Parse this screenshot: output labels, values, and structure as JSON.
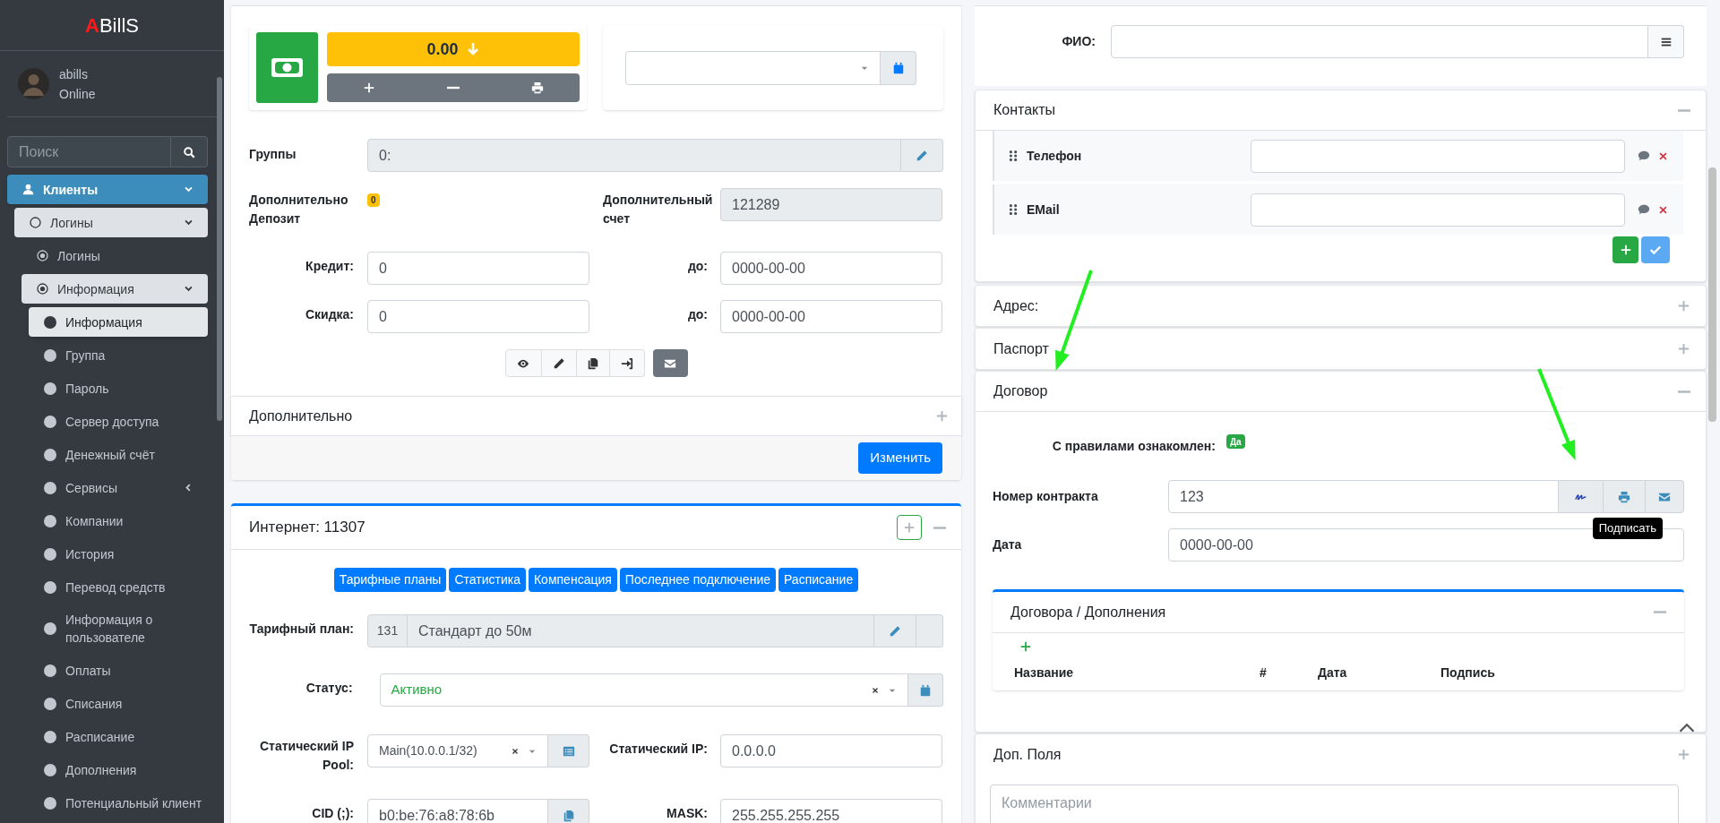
{
  "sidebar": {
    "logo": {
      "accent": "A",
      "rest": "BillS"
    },
    "user": {
      "name": "abills",
      "status": "Online"
    },
    "search": {
      "placeholder": "Поиск"
    },
    "menu": [
      {
        "label": "Клиенты",
        "kind": "user",
        "selected": true,
        "expanded": true,
        "children": [
          {
            "label": "Логины",
            "kind": "circle-outline",
            "selected": false,
            "expanded": true,
            "children": [
              {
                "label": "Логины",
                "kind": "dot-circle",
                "selected": false
              },
              {
                "label": "Информация",
                "kind": "dot-circle",
                "selected": false,
                "expanded": true,
                "children": [
                  {
                    "label": "Информация",
                    "kind": "circle",
                    "selected": true
                  },
                  {
                    "label": "Группа",
                    "kind": "circle",
                    "selected": false
                  },
                  {
                    "label": "Пароль",
                    "kind": "circle",
                    "selected": false
                  },
                  {
                    "label": "Сервер доступа",
                    "kind": "circle",
                    "selected": false
                  },
                  {
                    "label": "Денежный счёт",
                    "kind": "circle",
                    "selected": false
                  },
                  {
                    "label": "Сервисы",
                    "kind": "circle",
                    "selected": false,
                    "expanded": false
                  },
                  {
                    "label": "Компании",
                    "kind": "circle",
                    "selected": false
                  },
                  {
                    "label": "История",
                    "kind": "circle",
                    "selected": false
                  },
                  {
                    "label": "Перевод средств",
                    "kind": "circle",
                    "selected": false
                  },
                  {
                    "label": "Информация о пользователе",
                    "kind": "circle",
                    "selected": false
                  },
                  {
                    "label": "Оплаты",
                    "kind": "circle",
                    "selected": false
                  },
                  {
                    "label": "Списания",
                    "kind": "circle",
                    "selected": false
                  },
                  {
                    "label": "Расписание",
                    "kind": "circle",
                    "selected": false
                  },
                  {
                    "label": "Дополнения",
                    "kind": "circle",
                    "selected": false
                  },
                  {
                    "label": "Потенциальный клиент",
                    "kind": "circle",
                    "selected": false
                  }
                ]
              }
            ]
          }
        ]
      }
    ]
  },
  "balance": {
    "amount": "0.00"
  },
  "groups": {
    "label": "Группы",
    "value": "0:"
  },
  "extra_deposit": {
    "label": "Дополнительно Депозит",
    "badge": "0"
  },
  "extra_account": {
    "label": "Дополнительный счет",
    "value": "121289"
  },
  "credit": {
    "label": "Кредит:",
    "value": "0",
    "until_label": "до:",
    "until_value": "0000-00-00"
  },
  "discount": {
    "label": "Скидка:",
    "value": "0",
    "until_label": "до:",
    "until_value": "0000-00-00"
  },
  "additional_panel": {
    "title": "Дополнительно",
    "expanded": false
  },
  "submit_button": "Изменить",
  "internet": {
    "title": "Интернет: 11307",
    "tabs": [
      "Тарифные планы",
      "Статистика",
      "Компенсация",
      "Последнее подключение",
      "Расписание"
    ],
    "tariff": {
      "label": "Тарифный план:",
      "id": "131",
      "name": "Стандарт до 50м"
    },
    "status": {
      "label": "Статус:",
      "value": "Активно"
    },
    "ip_pool": {
      "label": "Статический IP Pool:",
      "value": "Main(10.0.0.1/32)"
    },
    "static_ip": {
      "label": "Статический IP:",
      "value": "0.0.0.0"
    },
    "cid": {
      "label": "CID (;):",
      "value": "b0:be:76:a8:78:6b"
    },
    "mask": {
      "label": "MASK:",
      "value": "255.255.255.255"
    }
  },
  "fio": {
    "label": "ФИО:"
  },
  "contacts": {
    "title": "Контакты",
    "expanded": true,
    "rows": [
      {
        "label": "Телефон"
      },
      {
        "label": "EMail"
      }
    ]
  },
  "address": {
    "title": "Адрес:",
    "expanded": false
  },
  "passport": {
    "title": "Паспорт",
    "expanded": false
  },
  "contract": {
    "title": "Договор",
    "expanded": true,
    "rules_label": "С правилами ознакомлен:",
    "rules_badge": "Да",
    "number_label": "Номер контракта",
    "number_value": "123",
    "date_label": "Дата",
    "date_value": "0000-00-00",
    "tooltip": "Подписать",
    "attachments": {
      "title": "Договора / Дополнения",
      "expanded": true,
      "columns": [
        "Название",
        "#",
        "Дата",
        "Подпись"
      ]
    }
  },
  "extra_fields": {
    "title": "Доп. Поля",
    "expanded": false
  },
  "comments": {
    "placeholder": "Комментарии"
  }
}
